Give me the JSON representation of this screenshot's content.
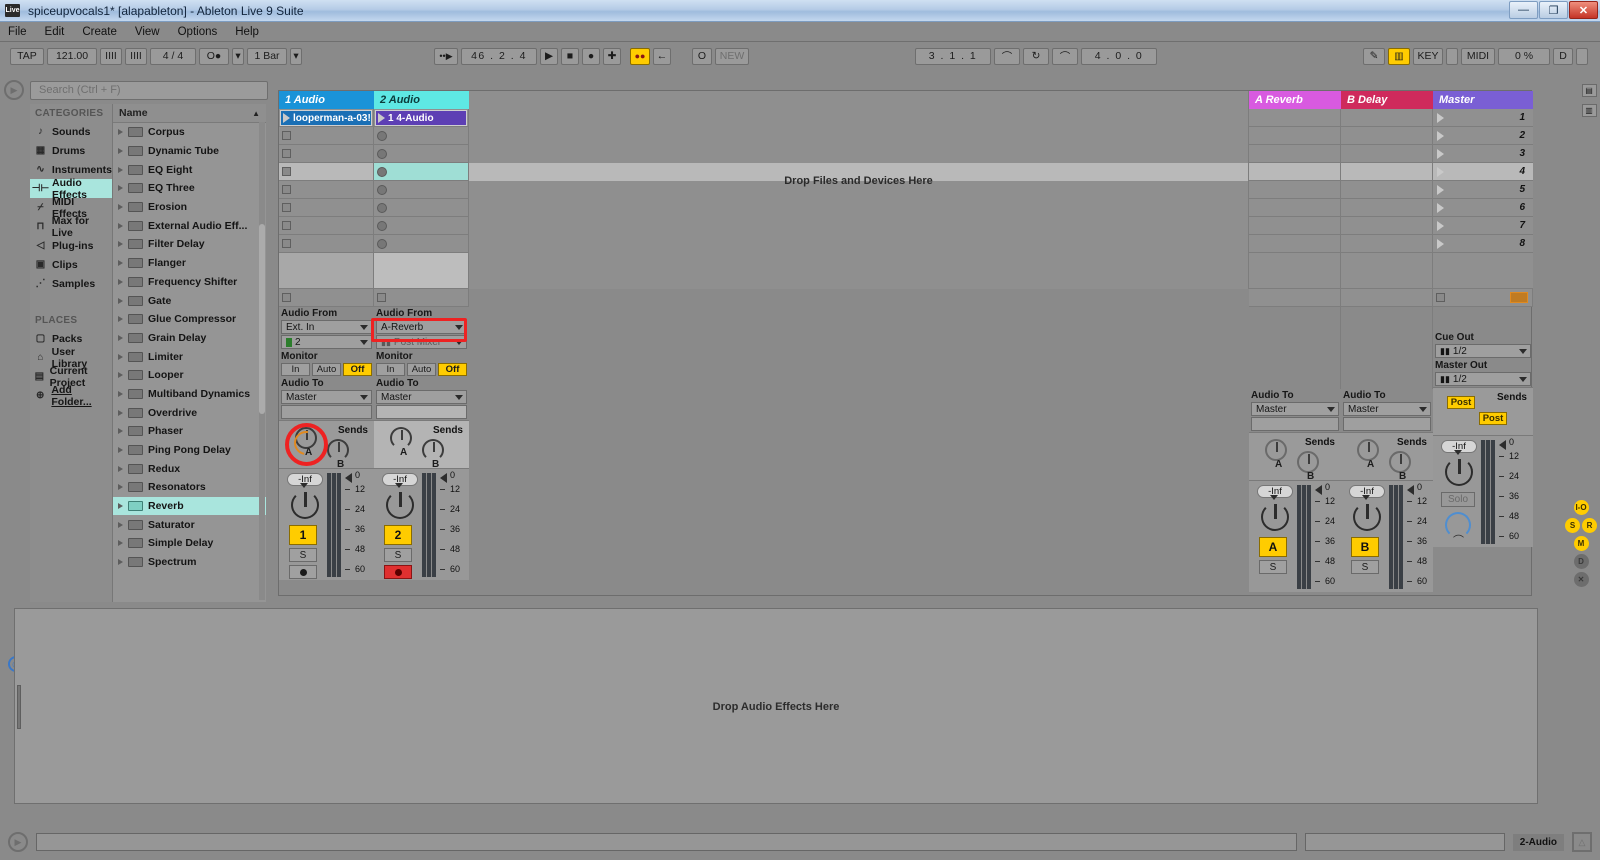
{
  "window": {
    "title": "spiceupvocals1*  [alapableton] - Ableton Live 9 Suite",
    "logo": "Live",
    "minimize": "—",
    "restore": "❐",
    "close": "✕"
  },
  "menu": [
    "File",
    "Edit",
    "Create",
    "View",
    "Options",
    "Help"
  ],
  "transport": {
    "tap": "TAP",
    "tempo": "121.00",
    "metro_a": "IIII",
    "metro_b": "IIII",
    "signature": "4 / 4",
    "follow": "O●",
    "quantize": "1 Bar",
    "nudge": "••▶",
    "position": "46 .  2 .  4",
    "play": "▶",
    "stop": "■",
    "record": "●",
    "overdub": "✚",
    "session_record": "🔴",
    "back": "←",
    "metronome": "O",
    "new_button": "NEW",
    "loop_start": "3 .  1 .  1",
    "punch_in": "⌒",
    "loop_toggle": "↻",
    "punch_out": "⌒",
    "loop_length": "4 .  0 .  0",
    "draw_mode": "✎",
    "midi_keys": "🎹",
    "key_map": "KEY",
    "midi_map": "MIDI",
    "cpu_load": "0 %",
    "disk": "D"
  },
  "browser": {
    "search_placeholder": "Search (Ctrl + F)",
    "categories_header": "CATEGORIES",
    "categories": [
      {
        "label": "Sounds",
        "icon": "note-icon",
        "selected": false
      },
      {
        "label": "Drums",
        "icon": "drums-icon",
        "selected": false
      },
      {
        "label": "Instruments",
        "icon": "wave-icon",
        "selected": false
      },
      {
        "label": "Audio Effects",
        "icon": "audio-effects-icon",
        "selected": true
      },
      {
        "label": "MIDI Effects",
        "icon": "midi-effects-icon",
        "selected": false
      },
      {
        "label": "Max for Live",
        "icon": "max-icon",
        "selected": false
      },
      {
        "label": "Plug-ins",
        "icon": "plugin-icon",
        "selected": false
      },
      {
        "label": "Clips",
        "icon": "clip-icon",
        "selected": false
      },
      {
        "label": "Samples",
        "icon": "sample-icon",
        "selected": false
      }
    ],
    "places_header": "PLACES",
    "places": [
      {
        "label": "Packs",
        "icon": "pack-icon"
      },
      {
        "label": "User Library",
        "icon": "user-icon"
      },
      {
        "label": "Current Project",
        "icon": "project-icon"
      },
      {
        "label": "Add Folder...",
        "icon": "add-icon"
      }
    ],
    "name_header": "Name",
    "devices": [
      {
        "label": "Corpus",
        "selected": false
      },
      {
        "label": "Dynamic Tube",
        "selected": false
      },
      {
        "label": "EQ Eight",
        "selected": false
      },
      {
        "label": "EQ Three",
        "selected": false
      },
      {
        "label": "Erosion",
        "selected": false
      },
      {
        "label": "External Audio Eff...",
        "selected": false
      },
      {
        "label": "Filter Delay",
        "selected": false
      },
      {
        "label": "Flanger",
        "selected": false
      },
      {
        "label": "Frequency Shifter",
        "selected": false
      },
      {
        "label": "Gate",
        "selected": false
      },
      {
        "label": "Glue Compressor",
        "selected": false
      },
      {
        "label": "Grain Delay",
        "selected": false
      },
      {
        "label": "Limiter",
        "selected": false
      },
      {
        "label": "Looper",
        "selected": false
      },
      {
        "label": "Multiband Dynamics",
        "selected": false
      },
      {
        "label": "Overdrive",
        "selected": false
      },
      {
        "label": "Phaser",
        "selected": false
      },
      {
        "label": "Ping Pong Delay",
        "selected": false
      },
      {
        "label": "Redux",
        "selected": false
      },
      {
        "label": "Resonators",
        "selected": false
      },
      {
        "label": "Reverb",
        "selected": true
      },
      {
        "label": "Saturator",
        "selected": false
      },
      {
        "label": "Simple Delay",
        "selected": false
      },
      {
        "label": "Spectrum",
        "selected": false
      }
    ]
  },
  "session": {
    "drop_files_text": "Drop Files and Devices Here",
    "scenes": [
      "1",
      "2",
      "3",
      "4",
      "5",
      "6",
      "7",
      "8"
    ],
    "tracks": [
      {
        "name": "1 Audio",
        "header_color": "#1a93d8",
        "clip": {
          "name": "looperman-a-03!",
          "color": "#1a6fb5",
          "has_clip": true
        },
        "audio_from_label": "Audio From",
        "audio_from": "Ext. In",
        "input_channel": "2",
        "monitor_label": "Monitor",
        "monitor": [
          "In",
          "Auto",
          "Off"
        ],
        "monitor_active": "Off",
        "audio_to_label": "Audio To",
        "audio_to": "Master",
        "sends_label": "Sends",
        "send_a": "A",
        "send_b": "B",
        "send_a_active": true,
        "volume": "-Inf",
        "track_number": "1",
        "solo": "S",
        "armed": false,
        "scale": [
          "0",
          "12",
          "24",
          "36",
          "48",
          "60"
        ]
      },
      {
        "name": "2 Audio",
        "header_color": "#5ee8e4",
        "header_text_color": "#0b3b3b",
        "clip": {
          "name": "1 4-Audio",
          "color": "#5d3fb4",
          "has_clip": true
        },
        "audio_from_label": "Audio From",
        "audio_from": "A-Reverb",
        "input_channel": "Post Mixer",
        "monitor_label": "Monitor",
        "monitor": [
          "In",
          "Auto",
          "Off"
        ],
        "monitor_active": "Off",
        "audio_to_label": "Audio To",
        "audio_to": "Master",
        "sends_label": "Sends",
        "send_a": "A",
        "send_b": "B",
        "send_a_active": false,
        "volume": "-Inf",
        "track_number": "2",
        "solo": "S",
        "armed": true,
        "scale": [
          "0",
          "12",
          "24",
          "36",
          "48",
          "60"
        ]
      }
    ],
    "returns": [
      {
        "name": "A Reverb",
        "header_color": "#d85ae0",
        "audio_to_label": "Audio To",
        "audio_to": "Master",
        "sends_label": "Sends",
        "send_a": "A",
        "send_b": "B",
        "volume": "-Inf",
        "track_number": "A",
        "solo": "S",
        "scale": [
          "0",
          "12",
          "24",
          "36",
          "48",
          "60"
        ]
      },
      {
        "name": "B Delay",
        "header_color": "#cf2a5c",
        "audio_to_label": "Audio To",
        "audio_to": "Master",
        "sends_label": "Sends",
        "send_a": "A",
        "send_b": "B",
        "volume": "-Inf",
        "track_number": "B",
        "solo": "S",
        "scale": [
          "0",
          "12",
          "24",
          "36",
          "48",
          "60"
        ]
      }
    ],
    "master": {
      "name": "Master",
      "header_color": "#7a5fd4",
      "cue_out_label": "Cue Out",
      "cue_out": "1/2",
      "master_out_label": "Master Out",
      "master_out": "1/2",
      "sends_label": "Sends",
      "post_a": "Post",
      "post_b": "Post",
      "volume": "-Inf",
      "track_number": "",
      "solo": "Solo",
      "scale": [
        "0",
        "12",
        "24",
        "36",
        "48",
        "60"
      ]
    }
  },
  "mixer_toggles": [
    {
      "label": "I-O",
      "on": true
    },
    {
      "label": "S",
      "on": true
    },
    {
      "label": "R",
      "on": true
    },
    {
      "label": "M",
      "on": true
    },
    {
      "label": "D",
      "on": false
    },
    {
      "label": "✕",
      "on": false
    }
  ],
  "device_area": {
    "drop_text": "Drop Audio Effects Here"
  },
  "status": {
    "track_status": "2-Audio"
  },
  "annotations": {
    "audio_from_highlight": "red-rectangle-audio-from",
    "send_a_highlight": "red-circle-send-a"
  },
  "colors": {
    "accent_yellow": "#ffcc00",
    "selection_cyan": "#a9e5dd",
    "annotation_red": "#ee2222"
  }
}
